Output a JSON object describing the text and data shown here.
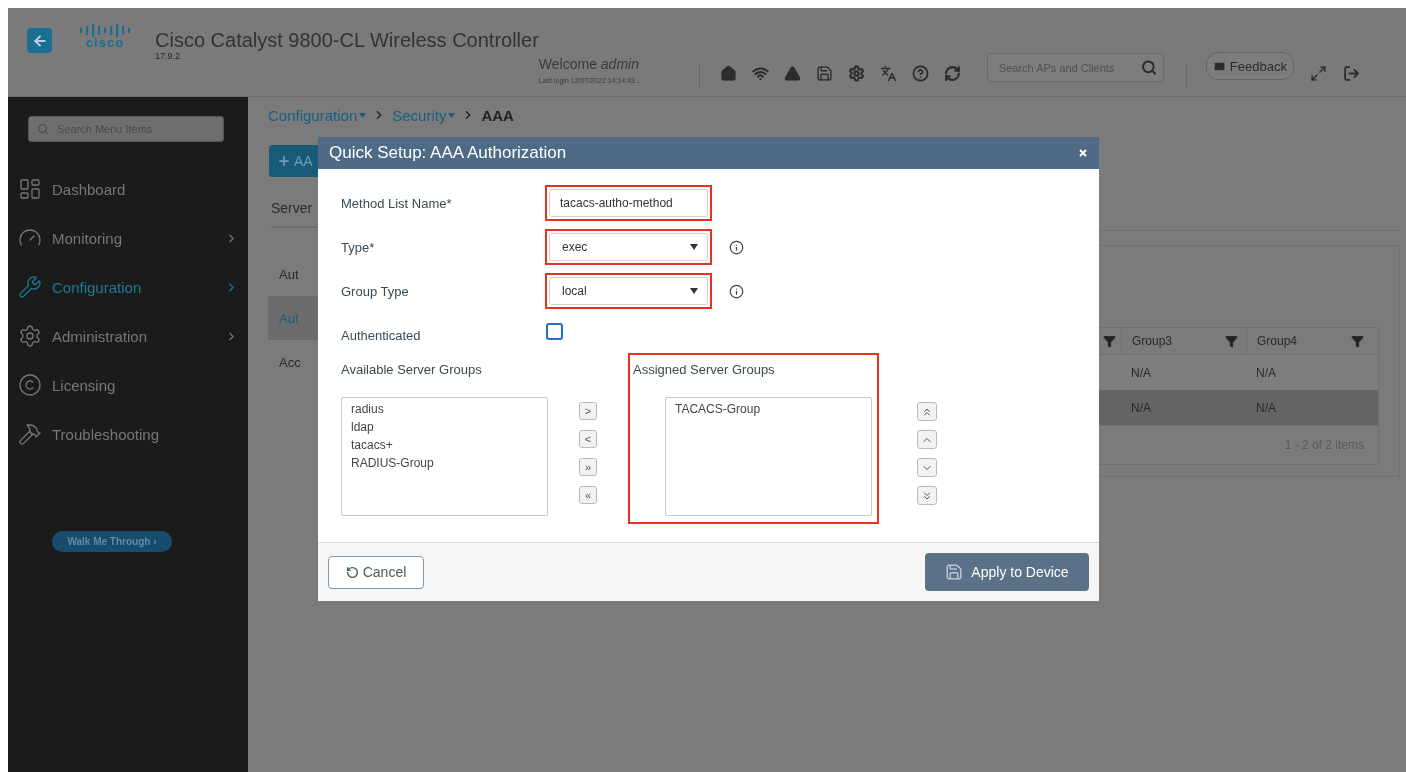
{
  "header": {
    "logo": "cisco",
    "title": "Cisco Catalyst 9800-CL Wireless Controller",
    "version": "17.9.2",
    "welcome": "Welcome",
    "user": "admin",
    "last_login": "Last login 12/07/2022 14:14:43 ...",
    "search": {
      "placeholder": "Search APs and Clients"
    },
    "feedback": "Feedback"
  },
  "sidebar": {
    "search": {
      "placeholder": "Search Menu Items"
    },
    "items": [
      {
        "kind": "dashboard",
        "label": "Dashboard",
        "selected": false,
        "expandable": false
      },
      {
        "kind": "monitoring",
        "label": "Monitoring",
        "selected": false,
        "expandable": true
      },
      {
        "kind": "configuration",
        "label": "Configuration",
        "selected": true,
        "expandable": true
      },
      {
        "kind": "administration",
        "label": "Administration",
        "selected": false,
        "expandable": true
      },
      {
        "kind": "licensing",
        "label": "Licensing",
        "selected": false,
        "expandable": false
      },
      {
        "kind": "troubleshooting",
        "label": "Troubleshooting",
        "selected": false,
        "expandable": false
      }
    ],
    "walk_button": "Walk Me Through ›"
  },
  "breadcrumb": [
    {
      "label": "Configuration",
      "dropdown": true
    },
    {
      "label": "Security",
      "dropdown": true
    },
    {
      "label": "AAA",
      "dropdown": false
    }
  ],
  "background": {
    "add_button": "AA",
    "tab": "Server",
    "list": [
      {
        "label": "Aut",
        "selected": false
      },
      {
        "label": "Aut",
        "selected": true
      },
      {
        "label": "Acc",
        "selected": false
      }
    ],
    "table": {
      "columns": [
        "Group3",
        "Group4"
      ],
      "rows": [
        {
          "cells": [
            "N/A",
            "N/A"
          ],
          "selected": false
        },
        {
          "cells": [
            "N/A",
            "N/A"
          ],
          "selected": true
        }
      ],
      "pager": "1 - 2 of 2 items"
    }
  },
  "dialog": {
    "title": "Quick Setup: AAA Authorization",
    "fields": [
      {
        "kind": "text",
        "label": "Method List Name*",
        "value": "tacacs-autho-method",
        "highlighted": true,
        "info": false
      },
      {
        "kind": "select",
        "label": "Type*",
        "value": "exec",
        "highlighted": true,
        "info": true
      },
      {
        "kind": "select",
        "label": "Group Type",
        "value": "local",
        "highlighted": true,
        "info": true
      },
      {
        "kind": "checkbox",
        "label": "Authenticated",
        "checked": false
      }
    ],
    "available": {
      "label": "Available Server Groups",
      "items": [
        "radius",
        "ldap",
        "tacacs+",
        "RADIUS-Group"
      ]
    },
    "move_buttons": [
      ">",
      "<",
      "»",
      "«"
    ],
    "assigned": {
      "label": "Assigned Server Groups",
      "items": [
        "TACACS-Group"
      ],
      "highlighted": true
    },
    "cancel": "Cancel",
    "apply": "Apply to Device"
  }
}
